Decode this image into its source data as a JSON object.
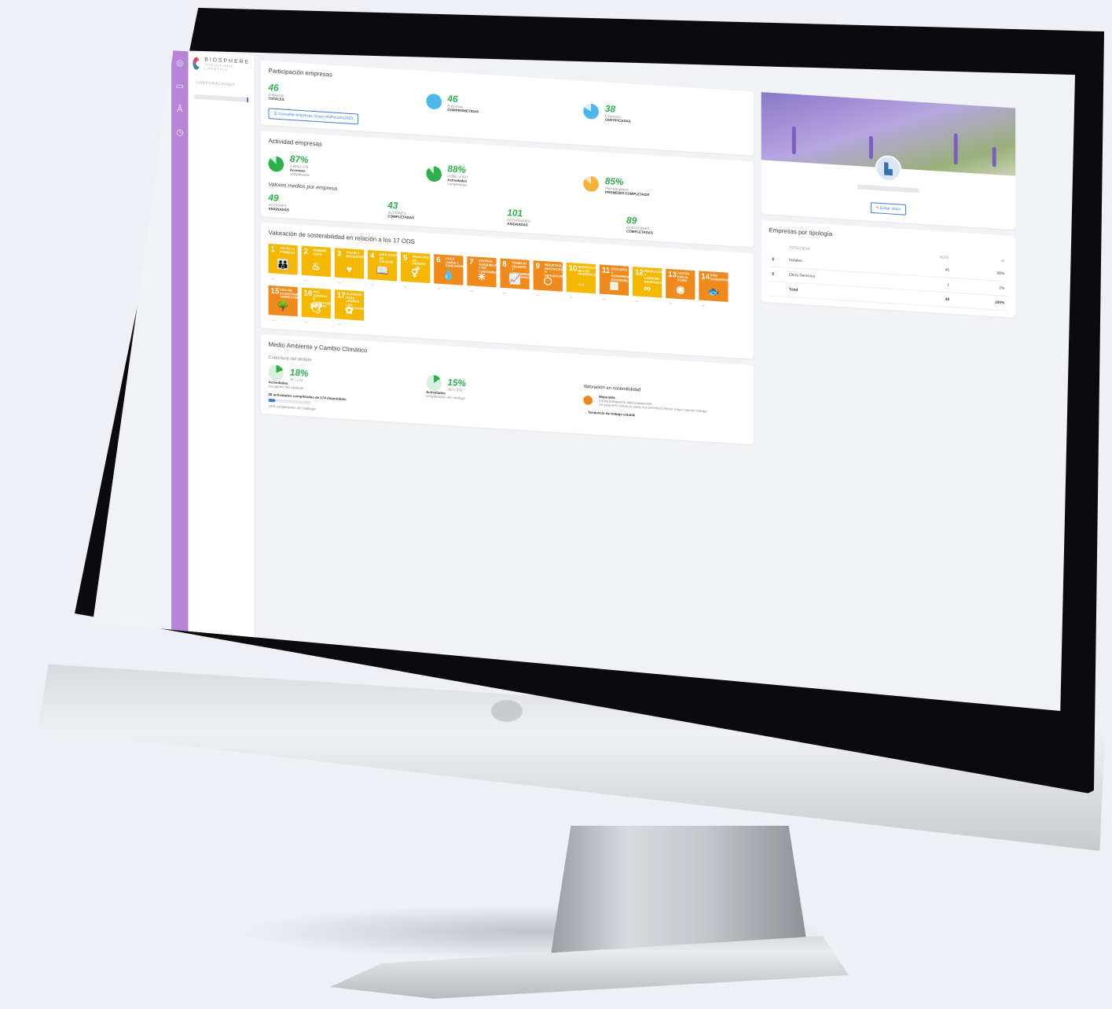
{
  "brand": {
    "name": "BIOSPHERE",
    "tagline": "SUSTAINABLE LIFESTYLE"
  },
  "nav": {
    "section": "CORPORACIONES"
  },
  "participacion": {
    "title": "Participación empresas",
    "totales": {
      "value": "46",
      "label": "Empresas",
      "sub": "TOTALES"
    },
    "comprometidas": {
      "value": "46",
      "label": "Empresas",
      "sub": "COMPROMETIDAS"
    },
    "certificadas": {
      "value": "38",
      "label": "Empresas",
      "sub": "CERTIFICADAS"
    },
    "button": "Consultar empresas Grupo AbiResorts2020"
  },
  "actividad": {
    "title": "Actividad empresas",
    "acciones": {
      "value": "87%",
      "detail": "1.965/2.278",
      "label": "Acciones",
      "sub": "completadas"
    },
    "actividades": {
      "value": "88%",
      "detail": "4.096 / 4.607",
      "label": "Actividades",
      "sub": "completadas"
    },
    "plan": {
      "value": "85%",
      "label": "Plan Biosphere",
      "sub": "PROMEDIO COMPLETADO"
    },
    "medios_title": "Valores medios por empresa",
    "medios": [
      {
        "value": "49",
        "label": "ACCIONES",
        "sub": "ASIGNADAS"
      },
      {
        "value": "43",
        "label": "ACCIONES",
        "sub": "COMPLETADAS"
      },
      {
        "value": "101",
        "label": "ACTIVIDADES",
        "sub": "ASIGNADAS"
      },
      {
        "value": "89",
        "label": "ACTIVIDADES",
        "sub": "COMPLETADAS"
      }
    ]
  },
  "ods": {
    "title": "Valoración de sostenibilidad en relación a los 17 ODS",
    "tiles": [
      {
        "n": "1",
        "name": "FIN DE LA POBREZA",
        "sym": "👪",
        "color": "#f5b800"
      },
      {
        "n": "2",
        "name": "HAMBRE CERO",
        "sym": "♨",
        "color": "#f5b800"
      },
      {
        "n": "3",
        "name": "SALUD Y BIENESTAR",
        "sym": "♥",
        "color": "#f5b800"
      },
      {
        "n": "4",
        "name": "EDUCACIÓN DE CALIDAD",
        "sym": "📖",
        "color": "#f5b800"
      },
      {
        "n": "5",
        "name": "IGUALDAD DE GÉNERO",
        "sym": "⚥",
        "color": "#f5b800"
      },
      {
        "n": "6",
        "name": "AGUA LIMPIA Y SANEAMIENTO",
        "sym": "💧",
        "color": "#f08a1c"
      },
      {
        "n": "7",
        "name": "ENERGÍA ASEQUIBLE Y NO CONTAMINANTE",
        "sym": "☀",
        "color": "#f08a1c"
      },
      {
        "n": "8",
        "name": "TRABAJO DECENTE Y CRECIMIENTO ECONÓMICO",
        "sym": "📈",
        "color": "#f08a1c"
      },
      {
        "n": "9",
        "name": "INDUSTRIA, INNOVACIÓN E INFRAESTRUCTURA",
        "sym": "⬡",
        "color": "#f08a1c"
      },
      {
        "n": "10",
        "name": "REDUCCIÓN DE LAS DESIGUALDADES",
        "sym": "⇔",
        "color": "#f5b800"
      },
      {
        "n": "11",
        "name": "CIUDADES Y COMUNIDADES SOSTENIBLES",
        "sym": "▦",
        "color": "#f08a1c"
      },
      {
        "n": "12",
        "name": "PRODUCCIÓN Y CONSUMO RESPONSABLES",
        "sym": "∞",
        "color": "#f5b800"
      },
      {
        "n": "13",
        "name": "ACCIÓN POR EL CLIMA",
        "sym": "◉",
        "color": "#f08a1c"
      },
      {
        "n": "14",
        "name": "VIDA SUBMARINA",
        "sym": "🐟",
        "color": "#f08a1c"
      },
      {
        "n": "15",
        "name": "VIDA DE ECOSISTEMAS TERRESTRES",
        "sym": "🌳",
        "color": "#f08a1c"
      },
      {
        "n": "16",
        "name": "PAZ, JUSTICIA E INSTITUCIONES SÓLIDAS",
        "sym": "🕊",
        "color": "#f5b800"
      },
      {
        "n": "17",
        "name": "ALIANZAS PARA LOGRAR LOS OBJETIVOS",
        "sym": "✿",
        "color": "#f5b800"
      }
    ],
    "arrow": "→"
  },
  "medio": {
    "title": "Medio Ambiente y Cambio Climático",
    "cobertura": "Cobertura del ámbito",
    "a": {
      "value": "18%",
      "detail": "35 / 174",
      "label": "Actividades",
      "sub": "escogidas del catálogo"
    },
    "b": {
      "value": "15%",
      "detail": "257 / 376",
      "label": "Actividades",
      "sub": "completadas del catálogo"
    },
    "bar_label": "28 actividades completadas de 174 disponibles",
    "bar_sub": "16% completadas del catálogo",
    "bar_fraction": 0.16,
    "val_title": "Valoración en sostenibilidad",
    "val_status": "Mejorable",
    "val_text1": "Estáis trabajando adecuadamente.",
    "val_text2": "Un pequeño esfuerzo extra nos permitirá ofrecer mejor vuestro trabajo.",
    "tendencia": "Tendencia de trabajo estable"
  },
  "profile": {
    "edit": "Editar datos"
  },
  "tipologia": {
    "title": "Empresas por tipología",
    "headers": [
      "TIPOLOGÍA",
      "NÚM.",
      "%"
    ],
    "rows": [
      {
        "name": "Hoteles",
        "num": "45",
        "pct": "98%"
      },
      {
        "name": "Otros Servicios",
        "num": "1",
        "pct": "2%"
      }
    ],
    "total": {
      "name": "Total",
      "num": "46",
      "pct": "100%"
    }
  },
  "colors": {
    "rail": "#b784d6",
    "green": "#2db04a",
    "blue": "#3a7bd5",
    "orange": "#f08a1c",
    "yellow": "#f5b800"
  }
}
